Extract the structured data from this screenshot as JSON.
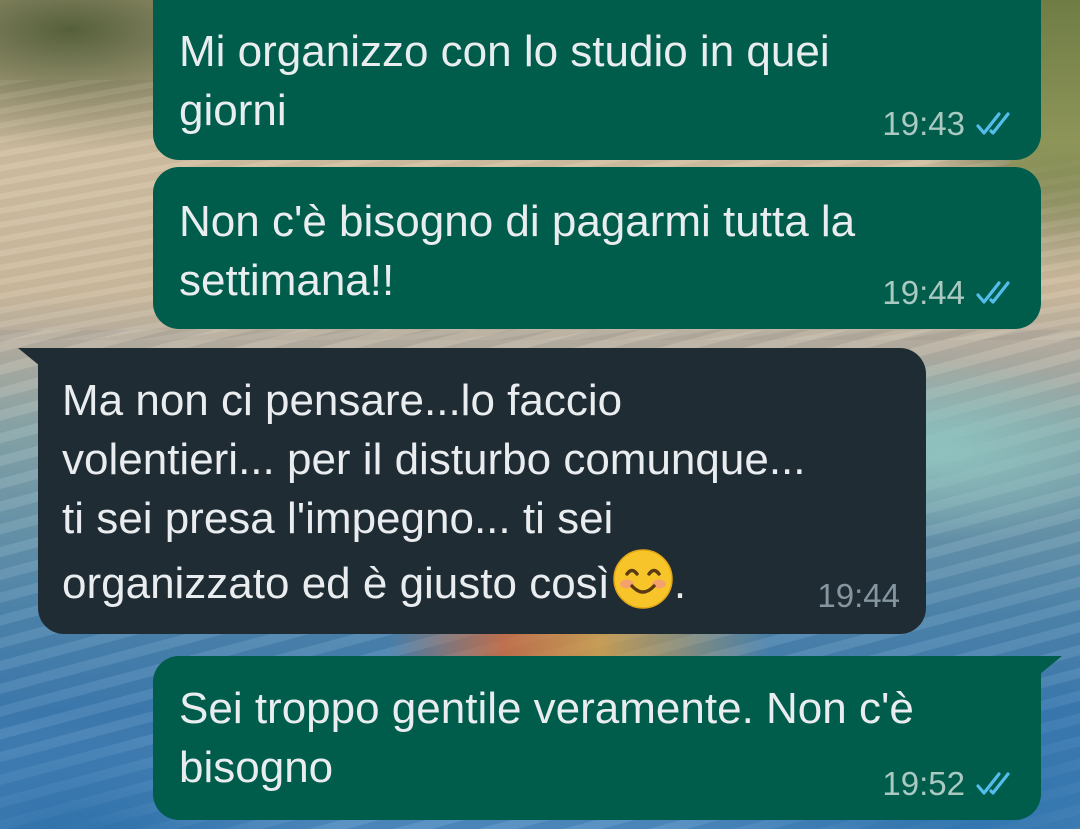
{
  "chat": {
    "messages": [
      {
        "direction": "outgoing",
        "text": "Mi organizzo con lo studio in quei\ngiorni",
        "time": "19:43",
        "status_icon": "double-check-read-icon"
      },
      {
        "direction": "outgoing",
        "text": "Non c'è bisogno di pagarmi tutta la\nsettimana!!",
        "time": "19:44",
        "status_icon": "double-check-read-icon"
      },
      {
        "direction": "incoming",
        "text": "Ma non ci pensare...lo faccio\nvolentieri... per il disturbo comunque...\nti sei presa l'impegno... ti sei\norganizzato ed è giusto così",
        "emoji": "smiling-face-icon",
        "trailing_text": ".",
        "time": "19:44"
      },
      {
        "direction": "outgoing",
        "text": "Sei troppo gentile veramente.  Non c'è\nbisogno",
        "time": "19:52",
        "status_icon": "double-check-read-icon"
      }
    ]
  },
  "colors": {
    "outgoing_bubble": "#005c4b",
    "incoming_bubble": "#202c33",
    "message_text": "#e9edef",
    "read_ticks": "#53bdeb"
  }
}
